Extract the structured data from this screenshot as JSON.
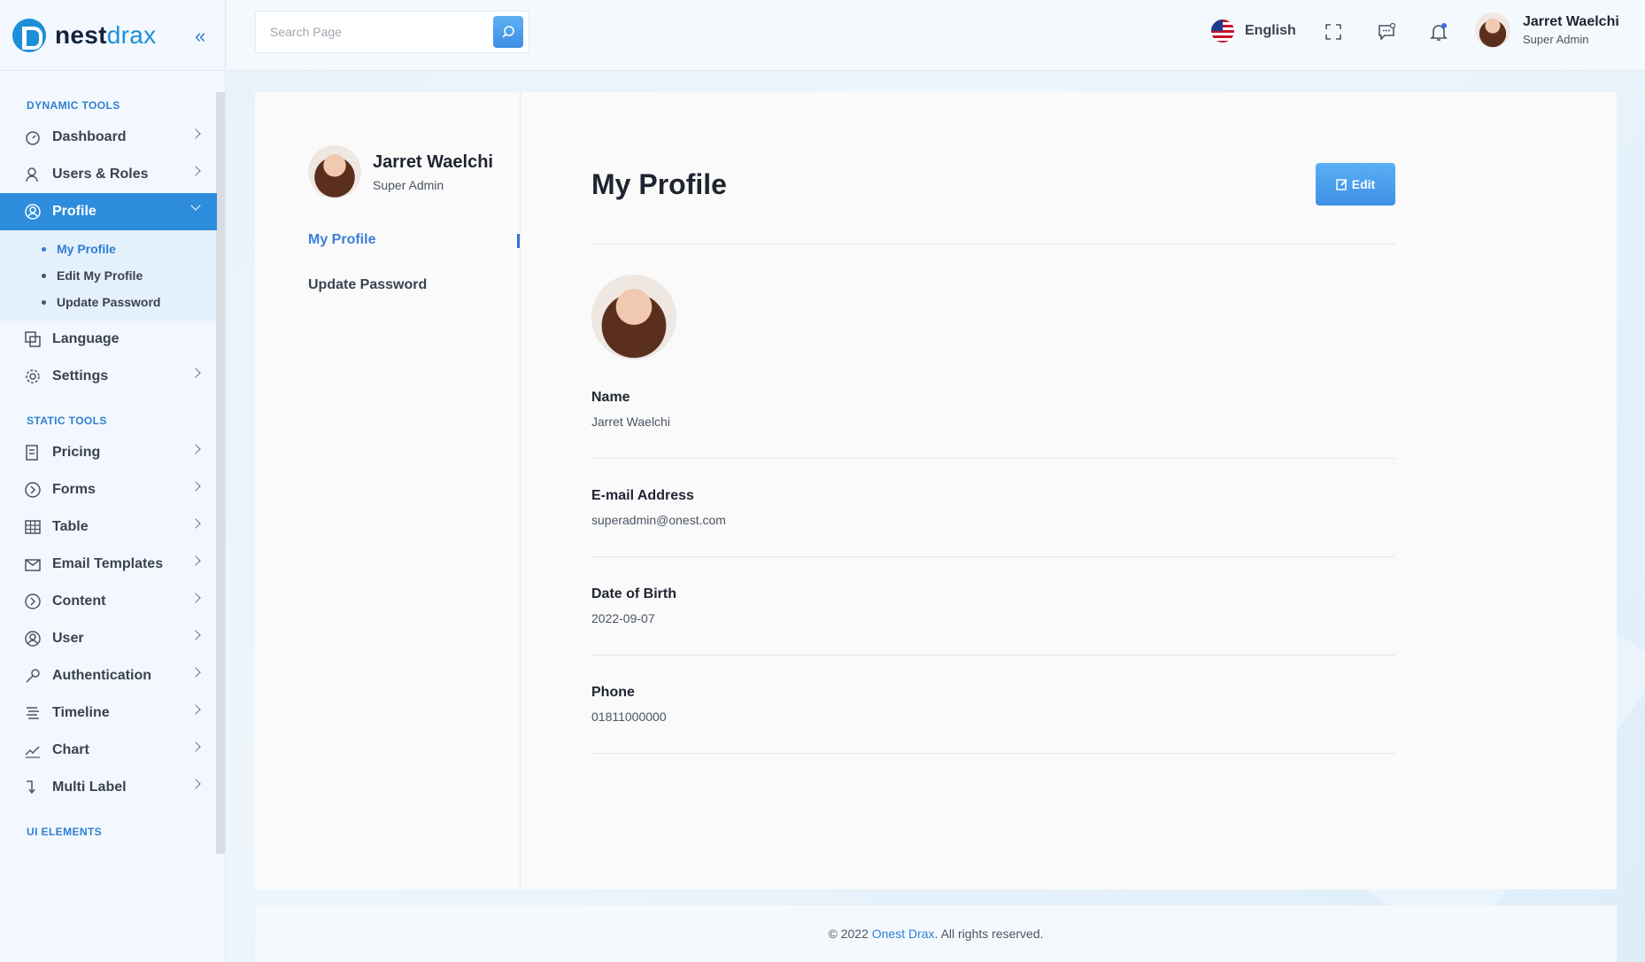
{
  "brand": {
    "name_part1": "nest",
    "name_part2": "drax"
  },
  "header": {
    "search_placeholder": "Search Page",
    "language": "English",
    "user_name": "Jarret Waelchi",
    "user_role": "Super Admin"
  },
  "sidebar": {
    "section_dynamic": "DYNAMIC TOOLS",
    "section_static": "STATIC TOOLS",
    "section_ui": "UI ELEMENTS",
    "dynamic_items": [
      {
        "label": "Dashboard",
        "icon": "dashboard-icon"
      },
      {
        "label": "Users & Roles",
        "icon": "users-icon"
      },
      {
        "label": "Profile",
        "icon": "profile-icon",
        "active": true
      }
    ],
    "profile_sub": [
      "My Profile",
      "Edit My Profile",
      "Update Password"
    ],
    "dynamic_items_2": [
      {
        "label": "Language",
        "icon": "language-icon"
      },
      {
        "label": "Settings",
        "icon": "gear-icon"
      }
    ],
    "static_items": [
      {
        "label": "Pricing",
        "icon": "pricing-icon"
      },
      {
        "label": "Forms",
        "icon": "forms-icon"
      },
      {
        "label": "Table",
        "icon": "table-icon"
      },
      {
        "label": "Email Templates",
        "icon": "email-icon"
      },
      {
        "label": "Content",
        "icon": "content-icon"
      },
      {
        "label": "User",
        "icon": "user-icon"
      },
      {
        "label": "Authentication",
        "icon": "key-icon"
      },
      {
        "label": "Timeline",
        "icon": "timeline-icon"
      },
      {
        "label": "Chart",
        "icon": "chart-icon"
      },
      {
        "label": "Multi Label",
        "icon": "multi-label-icon"
      }
    ]
  },
  "profile_panel": {
    "name": "Jarret Waelchi",
    "role": "Super Admin",
    "links": [
      "My Profile",
      "Update Password"
    ]
  },
  "main": {
    "title": "My Profile",
    "edit_label": "Edit",
    "fields": [
      {
        "label": "Name",
        "value": "Jarret Waelchi"
      },
      {
        "label": "E-mail Address",
        "value": "superadmin@onest.com"
      },
      {
        "label": "Date of Birth",
        "value": "2022-09-07"
      },
      {
        "label": "Phone",
        "value": "01811000000"
      }
    ]
  },
  "footer": {
    "prefix": "© 2022 ",
    "link": "Onest Drax",
    "suffix": ". All rights reserved."
  },
  "colors": {
    "accent": "#2e8cdc",
    "brand": "#1d8ed8"
  }
}
